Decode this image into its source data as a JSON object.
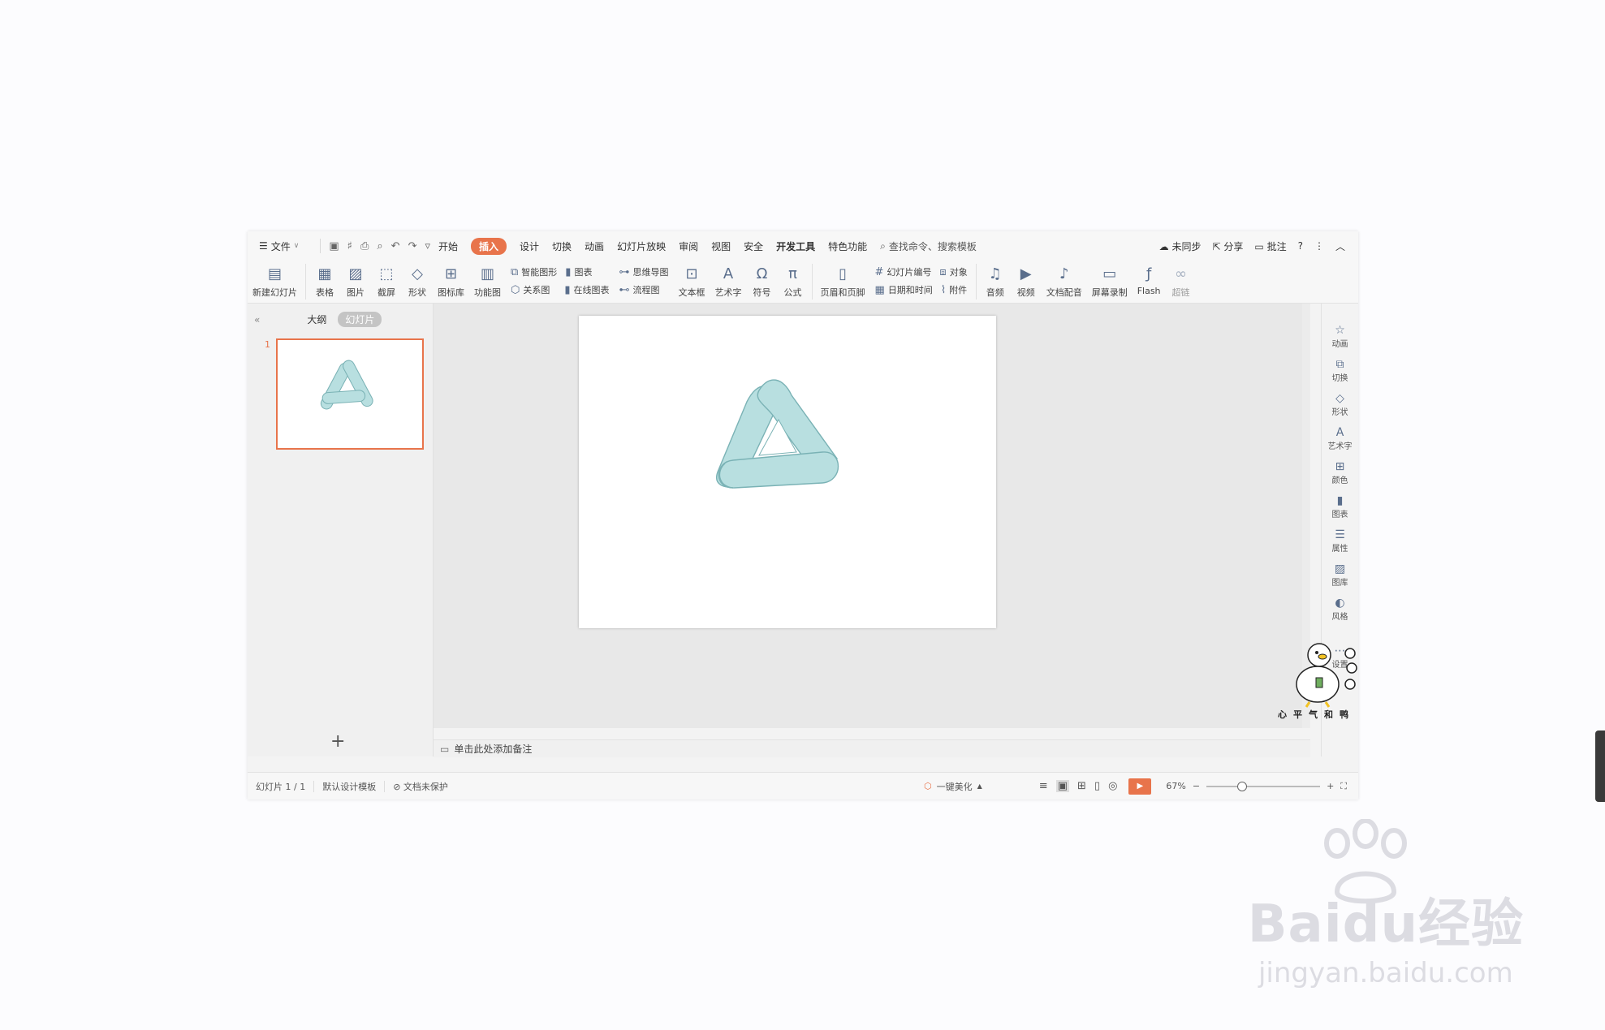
{
  "menu": {
    "file": "文件",
    "tabs": [
      {
        "label": "开始",
        "active": false,
        "bold": false
      },
      {
        "label": "插入",
        "active": true,
        "bold": false
      },
      {
        "label": "设计",
        "active": false,
        "bold": false
      },
      {
        "label": "切换",
        "active": false,
        "bold": false
      },
      {
        "label": "动画",
        "active": false,
        "bold": false
      },
      {
        "label": "幻灯片放映",
        "active": false,
        "bold": false
      },
      {
        "label": "审阅",
        "active": false,
        "bold": false
      },
      {
        "label": "视图",
        "active": false,
        "bold": false
      },
      {
        "label": "安全",
        "active": false,
        "bold": false
      },
      {
        "label": "开发工具",
        "active": false,
        "bold": true
      },
      {
        "label": "特色功能",
        "active": false,
        "bold": false
      }
    ],
    "search": "查找命令、搜索模板",
    "sync": "未同步",
    "share": "分享",
    "comment": "批注",
    "help": "?"
  },
  "ribbon": {
    "new_slide": "新建幻灯片",
    "table": "表格",
    "picture": "图片",
    "screenshot": "截屏",
    "shape": "形状",
    "icon_lib": "图标库",
    "func_chart": "功能图",
    "smart_art": "智能图形",
    "chart": "图表",
    "relation": "关系图",
    "online_chart": "在线图表",
    "mind_map": "思维导图",
    "flow_chart": "流程图",
    "textbox": "文本框",
    "art_text": "艺术字",
    "symbol": "符号",
    "formula": "公式",
    "header_footer": "页眉和页脚",
    "slide_number": "幻灯片编号",
    "object": "对象",
    "date_time": "日期和时间",
    "attachment": "附件",
    "audio": "音频",
    "video": "视频",
    "doc_dub": "文档配音",
    "screen_rec": "屏幕录制",
    "flash": "Flash",
    "hyperlink": "超链"
  },
  "left_panel": {
    "outline_tab": "大纲",
    "slides_tab": "幻灯片",
    "slide_number": "1",
    "add": "+"
  },
  "notes": {
    "placeholder": "单击此处添加备注"
  },
  "right_bar": {
    "items": [
      "动画",
      "切换",
      "形状",
      "艺术字",
      "颜色",
      "图表",
      "属性",
      "图库",
      "风格",
      "设置"
    ]
  },
  "status": {
    "slide_pos": "幻灯片 1 / 1",
    "template": "默认设计模板",
    "protect": "文档未保护",
    "beautify": "一键美化",
    "zoom": "67%"
  },
  "mascot_text": "心平气和鸭",
  "watermark": {
    "brand": "Baidu经验",
    "url": "jingyan.baidu.com"
  },
  "colors": {
    "accent": "#e8744b",
    "shape_fill": "#b8dfe0",
    "shape_stroke": "#7ab2b5"
  }
}
